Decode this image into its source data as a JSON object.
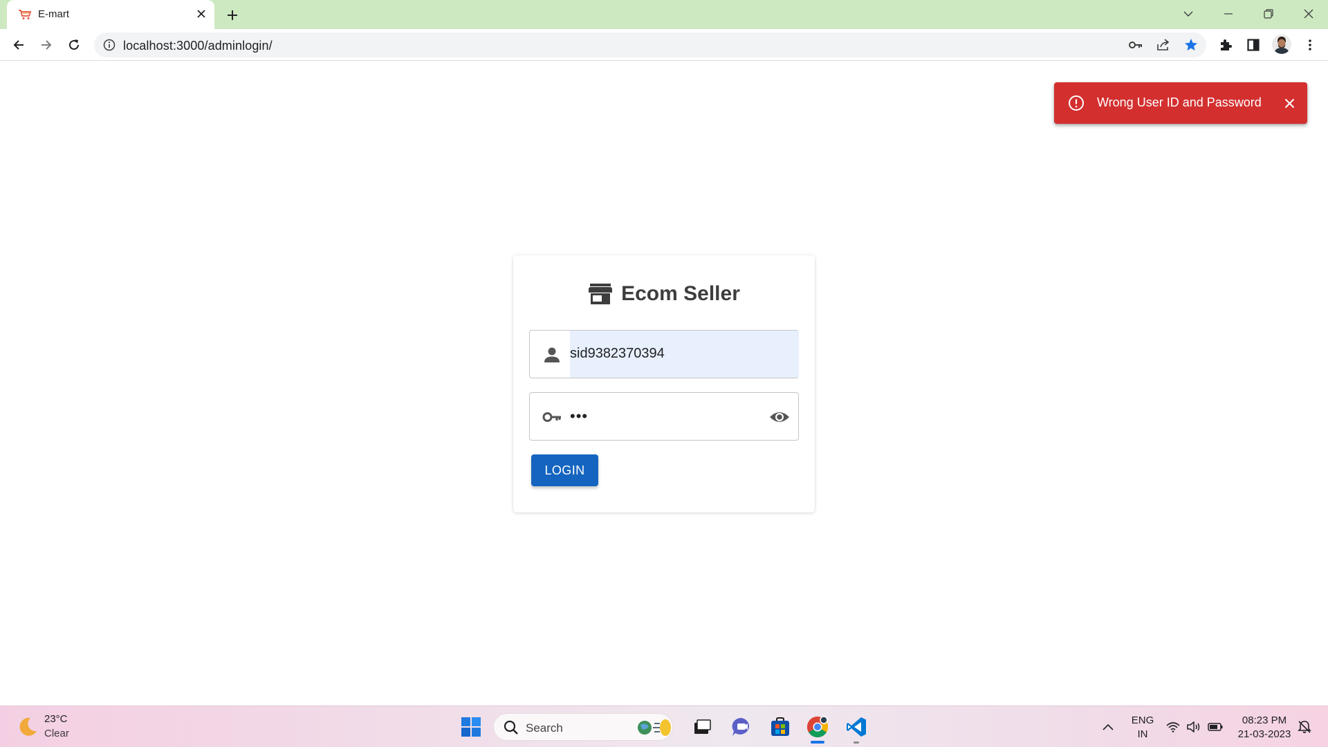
{
  "browser": {
    "tab_title": "E-mart",
    "url": "localhost:3000/adminlogin/"
  },
  "toast": {
    "message": "Wrong User ID and Password",
    "color": "#d32f2f"
  },
  "login": {
    "title": "Ecom Seller",
    "username_value": "sid9382370394",
    "password_mask": "•••",
    "login_label": "LOGIN",
    "button_color": "#1565c0"
  },
  "taskbar": {
    "temperature": "23°C",
    "weather": "Clear",
    "search_label": "Search",
    "language": "ENG",
    "region": "IN",
    "time": "08:23 PM",
    "date": "21-03-2023"
  }
}
